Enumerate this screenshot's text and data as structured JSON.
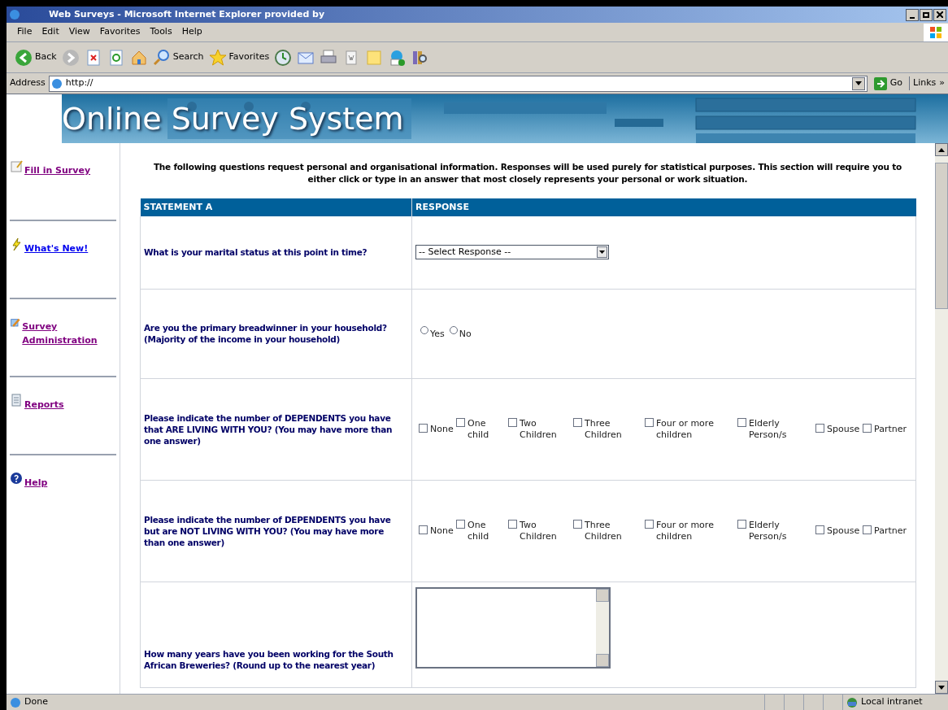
{
  "window": {
    "title": "Web Surveys - Microsoft Internet Explorer provided by"
  },
  "menu": [
    "File",
    "Edit",
    "View",
    "Favorites",
    "Tools",
    "Help"
  ],
  "toolbar": [
    {
      "kind": "back",
      "label": "Back"
    },
    {
      "kind": "forward"
    },
    {
      "kind": "stop"
    },
    {
      "kind": "refresh"
    },
    {
      "kind": "home"
    },
    {
      "kind": "search",
      "label": "Search"
    },
    {
      "kind": "favorites",
      "label": "Favorites"
    },
    {
      "kind": "history"
    },
    {
      "kind": "mail"
    },
    {
      "kind": "print"
    },
    {
      "kind": "edit"
    },
    {
      "kind": "note"
    },
    {
      "kind": "messenger"
    },
    {
      "kind": "research"
    }
  ],
  "address": {
    "label": "Address",
    "value": "http://",
    "go": "Go",
    "links": "Links",
    "more": "»"
  },
  "banner": {
    "title": "Online Survey System"
  },
  "sidebar": {
    "items": [
      {
        "kind": "note",
        "label": "Fill in Survey",
        "visited": true
      },
      {
        "kind": "bolt",
        "label": "What's New!",
        "visited": false
      },
      {
        "kind": "admin",
        "label": "Survey Administration",
        "visited": true
      },
      {
        "kind": "report",
        "label": "Reports",
        "visited": true
      },
      {
        "kind": "help",
        "label": "Help",
        "visited": true
      }
    ]
  },
  "intro": "The following questions request personal and organisational information. Responses will be used purely for statistical purposes. This section will require you to either click or type in an answer that most closely represents your personal or work situation.",
  "table": {
    "columns": [
      "STATEMENT A",
      "RESPONSE"
    ],
    "rows": [
      {
        "question": "What is your marital status at this point in time?",
        "kind": "select",
        "value": "-- Select Response --"
      },
      {
        "question": "Are you the primary breadwinner in your household? (Majority of the income in your household)",
        "kind": "radio",
        "options": [
          {
            "label": "Yes",
            "selected": false
          },
          {
            "label": "No",
            "selected": false
          }
        ]
      },
      {
        "question": "Please indicate the number of DEPENDENTS you have that ARE LIVING WITH YOU? (You may have more than one answer)",
        "kind": "checkbox",
        "options": [
          {
            "label": "None",
            "checked": false
          },
          {
            "label": "One child",
            "checked": false
          },
          {
            "label": "Two Children",
            "checked": false
          },
          {
            "label": "Three Children",
            "checked": false
          },
          {
            "label": "Four or more children",
            "checked": false
          },
          {
            "label": "Elderly Person/s",
            "checked": false
          },
          {
            "label": "Spouse",
            "checked": false
          },
          {
            "label": "Partner",
            "checked": false
          }
        ]
      },
      {
        "question": "Please indicate the number of DEPENDENTS you have but are NOT LIVING WITH YOU? (You may have more than one answer)",
        "kind": "checkbox",
        "options": [
          {
            "label": "None",
            "checked": false
          },
          {
            "label": "One child",
            "checked": false
          },
          {
            "label": "Two Children",
            "checked": false
          },
          {
            "label": "Three Children",
            "checked": false
          },
          {
            "label": "Four or more children",
            "checked": false
          },
          {
            "label": "Elderly Person/s",
            "checked": false
          },
          {
            "label": "Spouse",
            "checked": false
          },
          {
            "label": "Partner",
            "checked": false
          }
        ]
      },
      {
        "question": "How many years have you been working for the South African Breweries? (Round up to the nearest year)",
        "kind": "textarea"
      }
    ]
  },
  "status_bar": {
    "text": "Done",
    "zone": "Local intranet"
  }
}
